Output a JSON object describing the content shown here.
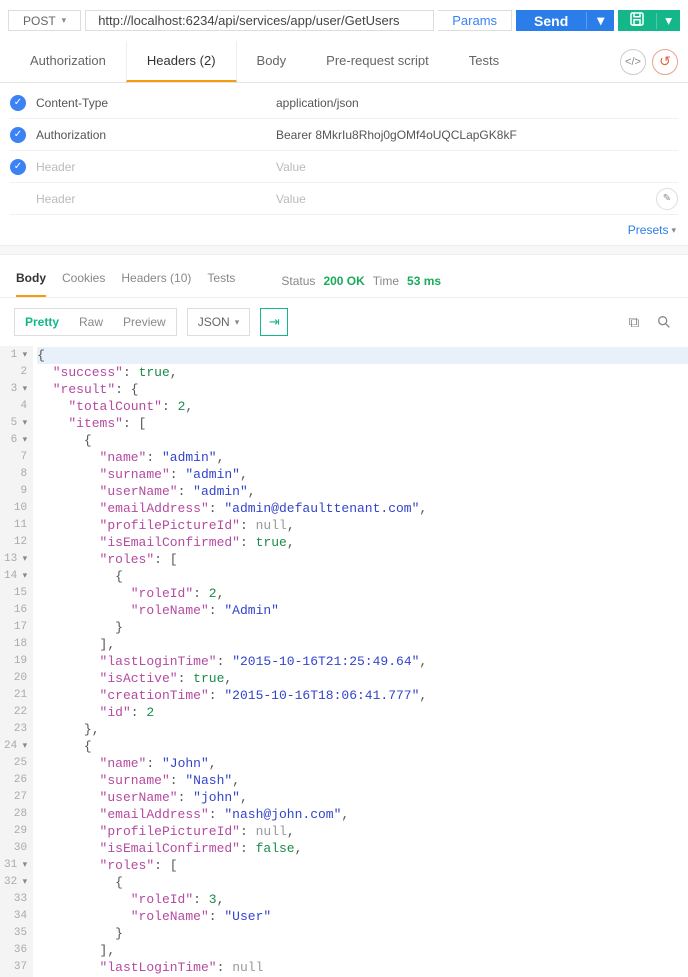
{
  "request": {
    "method": "POST",
    "url": "http://localhost:6234/api/services/app/user/GetUsers",
    "params_label": "Params",
    "send_label": "Send"
  },
  "req_tabs": {
    "auth": "Authorization",
    "headers": "Headers (2)",
    "body": "Body",
    "prerequest": "Pre-request script",
    "tests": "Tests"
  },
  "headers": [
    {
      "key": "Content-Type",
      "value": "application/json",
      "checked": true
    },
    {
      "key": "Authorization",
      "value": "Bearer 8MkrIu8Rhoj0gOMf4oUQCLapGK8kF",
      "checked": true
    },
    {
      "key": "",
      "value": "",
      "checked": true,
      "placeholderKey": "Header",
      "placeholderValue": "Value"
    },
    {
      "key": "",
      "value": "",
      "checked": false,
      "placeholderKey": "Header",
      "placeholderValue": "Value",
      "editIcon": true
    }
  ],
  "presets_label": "Presets",
  "response": {
    "tabs": {
      "body": "Body",
      "cookies": "Cookies",
      "headers": "Headers (10)",
      "tests": "Tests"
    },
    "status_label": "Status",
    "status_value": "200 OK",
    "time_label": "Time",
    "time_value": "53 ms",
    "format_buttons": {
      "pretty": "Pretty",
      "raw": "Raw",
      "preview": "Preview"
    },
    "type_select": "JSON"
  },
  "json_lines": [
    {
      "n": 1,
      "fold": true,
      "t": [
        [
          "p",
          "{"
        ]
      ]
    },
    {
      "n": 2,
      "t": [
        [
          "p",
          "  "
        ],
        [
          "k",
          "\"success\""
        ],
        [
          "p",
          ": "
        ],
        [
          "b",
          "true"
        ],
        [
          "p",
          ","
        ]
      ]
    },
    {
      "n": 3,
      "fold": true,
      "t": [
        [
          "p",
          "  "
        ],
        [
          "k",
          "\"result\""
        ],
        [
          "p",
          ": {"
        ]
      ]
    },
    {
      "n": 4,
      "t": [
        [
          "p",
          "    "
        ],
        [
          "k",
          "\"totalCount\""
        ],
        [
          "p",
          ": "
        ],
        [
          "n",
          "2"
        ],
        [
          "p",
          ","
        ]
      ]
    },
    {
      "n": 5,
      "fold": true,
      "t": [
        [
          "p",
          "    "
        ],
        [
          "k",
          "\"items\""
        ],
        [
          "p",
          ": ["
        ]
      ]
    },
    {
      "n": 6,
      "fold": true,
      "t": [
        [
          "p",
          "      {"
        ]
      ]
    },
    {
      "n": 7,
      "t": [
        [
          "p",
          "        "
        ],
        [
          "k",
          "\"name\""
        ],
        [
          "p",
          ": "
        ],
        [
          "s",
          "\"admin\""
        ],
        [
          "p",
          ","
        ]
      ]
    },
    {
      "n": 8,
      "t": [
        [
          "p",
          "        "
        ],
        [
          "k",
          "\"surname\""
        ],
        [
          "p",
          ": "
        ],
        [
          "s",
          "\"admin\""
        ],
        [
          "p",
          ","
        ]
      ]
    },
    {
      "n": 9,
      "t": [
        [
          "p",
          "        "
        ],
        [
          "k",
          "\"userName\""
        ],
        [
          "p",
          ": "
        ],
        [
          "s",
          "\"admin\""
        ],
        [
          "p",
          ","
        ]
      ]
    },
    {
      "n": 10,
      "t": [
        [
          "p",
          "        "
        ],
        [
          "k",
          "\"emailAddress\""
        ],
        [
          "p",
          ": "
        ],
        [
          "s",
          "\"admin@defaulttenant.com\""
        ],
        [
          "p",
          ","
        ]
      ]
    },
    {
      "n": 11,
      "t": [
        [
          "p",
          "        "
        ],
        [
          "k",
          "\"profilePictureId\""
        ],
        [
          "p",
          ": "
        ],
        [
          "nl",
          "null"
        ],
        [
          "p",
          ","
        ]
      ]
    },
    {
      "n": 12,
      "t": [
        [
          "p",
          "        "
        ],
        [
          "k",
          "\"isEmailConfirmed\""
        ],
        [
          "p",
          ": "
        ],
        [
          "b",
          "true"
        ],
        [
          "p",
          ","
        ]
      ]
    },
    {
      "n": 13,
      "fold": true,
      "t": [
        [
          "p",
          "        "
        ],
        [
          "k",
          "\"roles\""
        ],
        [
          "p",
          ": ["
        ]
      ]
    },
    {
      "n": 14,
      "fold": true,
      "t": [
        [
          "p",
          "          {"
        ]
      ]
    },
    {
      "n": 15,
      "t": [
        [
          "p",
          "            "
        ],
        [
          "k",
          "\"roleId\""
        ],
        [
          "p",
          ": "
        ],
        [
          "n",
          "2"
        ],
        [
          "p",
          ","
        ]
      ]
    },
    {
      "n": 16,
      "t": [
        [
          "p",
          "            "
        ],
        [
          "k",
          "\"roleName\""
        ],
        [
          "p",
          ": "
        ],
        [
          "s",
          "\"Admin\""
        ]
      ]
    },
    {
      "n": 17,
      "t": [
        [
          "p",
          "          }"
        ]
      ]
    },
    {
      "n": 18,
      "t": [
        [
          "p",
          "        ],"
        ]
      ]
    },
    {
      "n": 19,
      "t": [
        [
          "p",
          "        "
        ],
        [
          "k",
          "\"lastLoginTime\""
        ],
        [
          "p",
          ": "
        ],
        [
          "s",
          "\"2015-10-16T21:25:49.64\""
        ],
        [
          "p",
          ","
        ]
      ]
    },
    {
      "n": 20,
      "t": [
        [
          "p",
          "        "
        ],
        [
          "k",
          "\"isActive\""
        ],
        [
          "p",
          ": "
        ],
        [
          "b",
          "true"
        ],
        [
          "p",
          ","
        ]
      ]
    },
    {
      "n": 21,
      "t": [
        [
          "p",
          "        "
        ],
        [
          "k",
          "\"creationTime\""
        ],
        [
          "p",
          ": "
        ],
        [
          "s",
          "\"2015-10-16T18:06:41.777\""
        ],
        [
          "p",
          ","
        ]
      ]
    },
    {
      "n": 22,
      "t": [
        [
          "p",
          "        "
        ],
        [
          "k",
          "\"id\""
        ],
        [
          "p",
          ": "
        ],
        [
          "n",
          "2"
        ]
      ]
    },
    {
      "n": 23,
      "t": [
        [
          "p",
          "      },"
        ]
      ]
    },
    {
      "n": 24,
      "fold": true,
      "t": [
        [
          "p",
          "      {"
        ]
      ]
    },
    {
      "n": 25,
      "t": [
        [
          "p",
          "        "
        ],
        [
          "k",
          "\"name\""
        ],
        [
          "p",
          ": "
        ],
        [
          "s",
          "\"John\""
        ],
        [
          "p",
          ","
        ]
      ]
    },
    {
      "n": 26,
      "t": [
        [
          "p",
          "        "
        ],
        [
          "k",
          "\"surname\""
        ],
        [
          "p",
          ": "
        ],
        [
          "s",
          "\"Nash\""
        ],
        [
          "p",
          ","
        ]
      ]
    },
    {
      "n": 27,
      "t": [
        [
          "p",
          "        "
        ],
        [
          "k",
          "\"userName\""
        ],
        [
          "p",
          ": "
        ],
        [
          "s",
          "\"john\""
        ],
        [
          "p",
          ","
        ]
      ]
    },
    {
      "n": 28,
      "t": [
        [
          "p",
          "        "
        ],
        [
          "k",
          "\"emailAddress\""
        ],
        [
          "p",
          ": "
        ],
        [
          "s",
          "\"nash@john.com\""
        ],
        [
          "p",
          ","
        ]
      ]
    },
    {
      "n": 29,
      "t": [
        [
          "p",
          "        "
        ],
        [
          "k",
          "\"profilePictureId\""
        ],
        [
          "p",
          ": "
        ],
        [
          "nl",
          "null"
        ],
        [
          "p",
          ","
        ]
      ]
    },
    {
      "n": 30,
      "t": [
        [
          "p",
          "        "
        ],
        [
          "k",
          "\"isEmailConfirmed\""
        ],
        [
          "p",
          ": "
        ],
        [
          "b",
          "false"
        ],
        [
          "p",
          ","
        ]
      ]
    },
    {
      "n": 31,
      "fold": true,
      "t": [
        [
          "p",
          "        "
        ],
        [
          "k",
          "\"roles\""
        ],
        [
          "p",
          ": ["
        ]
      ]
    },
    {
      "n": 32,
      "fold": true,
      "t": [
        [
          "p",
          "          {"
        ]
      ]
    },
    {
      "n": 33,
      "t": [
        [
          "p",
          "            "
        ],
        [
          "k",
          "\"roleId\""
        ],
        [
          "p",
          ": "
        ],
        [
          "n",
          "3"
        ],
        [
          "p",
          ","
        ]
      ]
    },
    {
      "n": 34,
      "t": [
        [
          "p",
          "            "
        ],
        [
          "k",
          "\"roleName\""
        ],
        [
          "p",
          ": "
        ],
        [
          "s",
          "\"User\""
        ]
      ]
    },
    {
      "n": 35,
      "t": [
        [
          "p",
          "          }"
        ]
      ]
    },
    {
      "n": 36,
      "t": [
        [
          "p",
          "        ],"
        ]
      ]
    },
    {
      "n": 37,
      "t": [
        [
          "p",
          "        "
        ],
        [
          "k",
          "\"lastLoginTime\""
        ],
        [
          "p",
          ": "
        ],
        [
          "nl",
          "null"
        ]
      ]
    }
  ]
}
